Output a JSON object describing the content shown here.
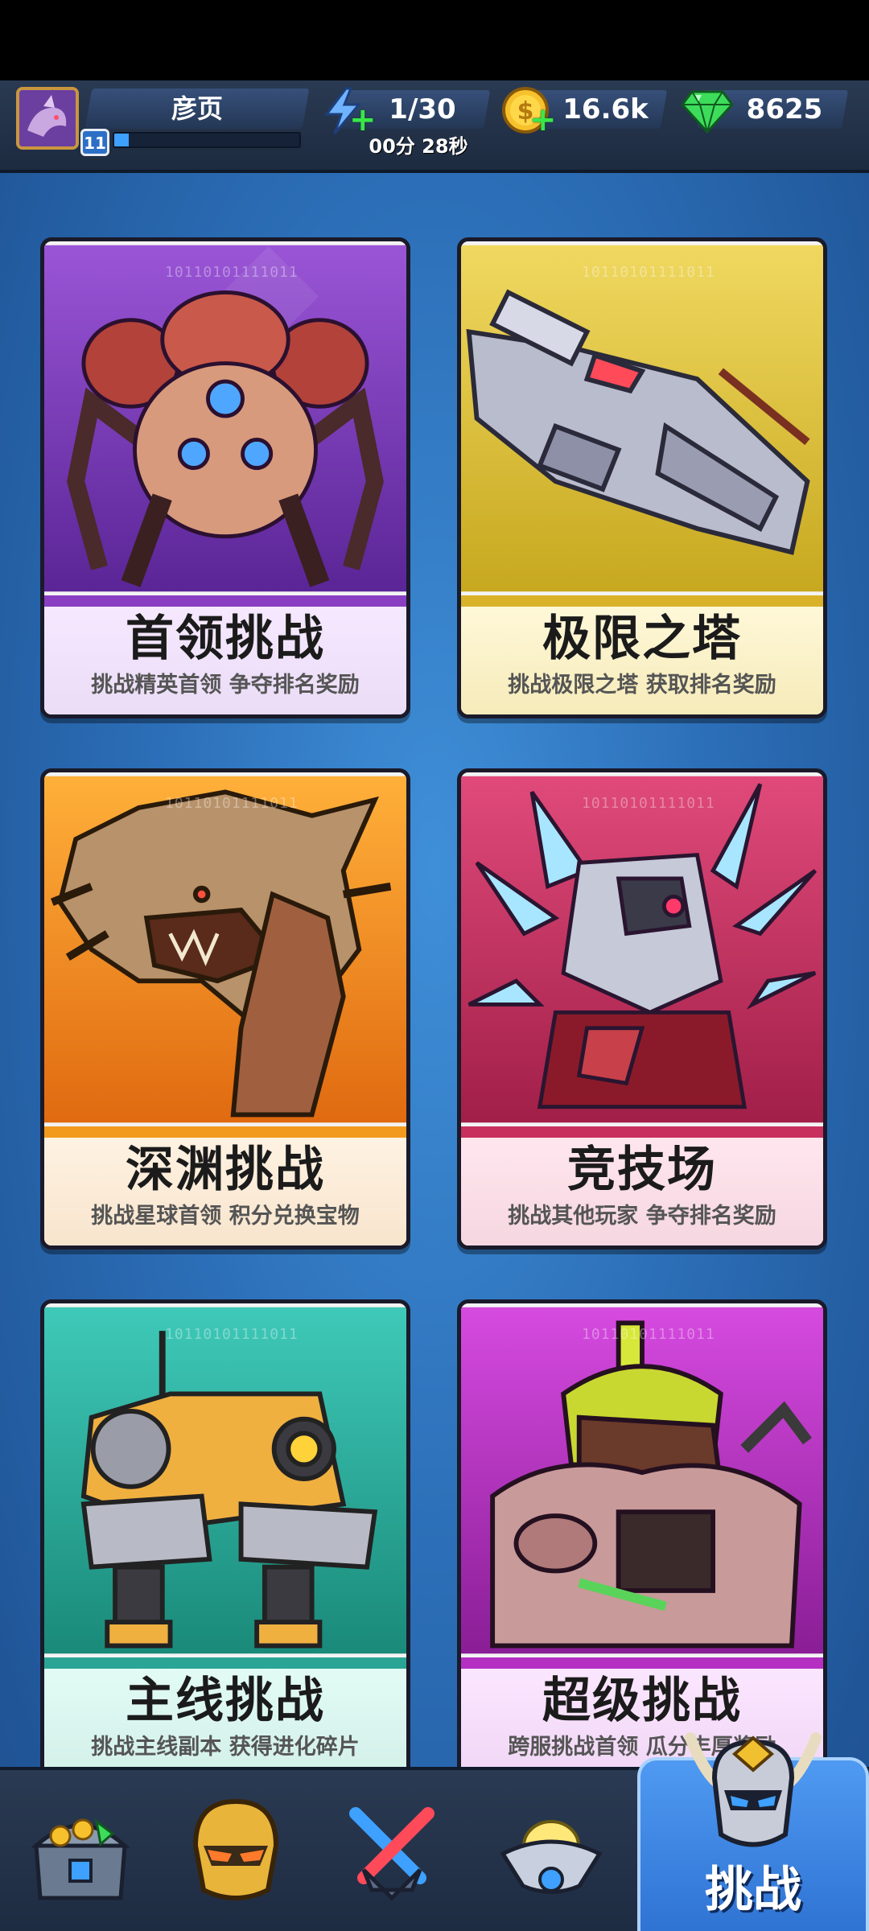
{
  "player": {
    "name": "彦页",
    "level": "11",
    "xp_fraction": 0.08
  },
  "resources": {
    "energy": {
      "value": "1/30",
      "timer": "00分 28秒",
      "icon": "lightning-icon"
    },
    "coins": {
      "value": "16.6k",
      "icon": "dollar-coin-icon"
    },
    "gems": {
      "value": "8625",
      "icon": "green-gem-icon"
    }
  },
  "cards": [
    {
      "title": "首领挑战",
      "subtitle": "挑战精英首领  争夺排名奖励",
      "code": "10110101111011",
      "color": "#8a3fc2"
    },
    {
      "title": "极限之塔",
      "subtitle": "挑战极限之塔 获取排名奖励",
      "code": "10110101111011",
      "color": "#e6c43a"
    },
    {
      "title": "深渊挑战",
      "subtitle": "挑战星球首领 积分兑换宝物",
      "code": "10110101111011",
      "color": "#f29a1e"
    },
    {
      "title": "竞技场",
      "subtitle": "挑战其他玩家 争夺排名奖励",
      "code": "10110101111011",
      "color": "#d63a6a"
    },
    {
      "title": "主线挑战",
      "subtitle": "挑战主线副本 获得进化碎片",
      "code": "10110101111011",
      "color": "#2bb3a3"
    },
    {
      "title": "超级挑战",
      "subtitle": "跨服挑战首领 瓜分丰厚奖励",
      "code": "10110101111011",
      "color": "#c43ad1"
    }
  ],
  "nav": {
    "items": [
      "treasure-chest-icon",
      "golden-helmet-icon",
      "crossed-swords-icon",
      "ufo-icon"
    ],
    "active_label": "挑战",
    "active_icon": "horned-helmet-icon"
  }
}
